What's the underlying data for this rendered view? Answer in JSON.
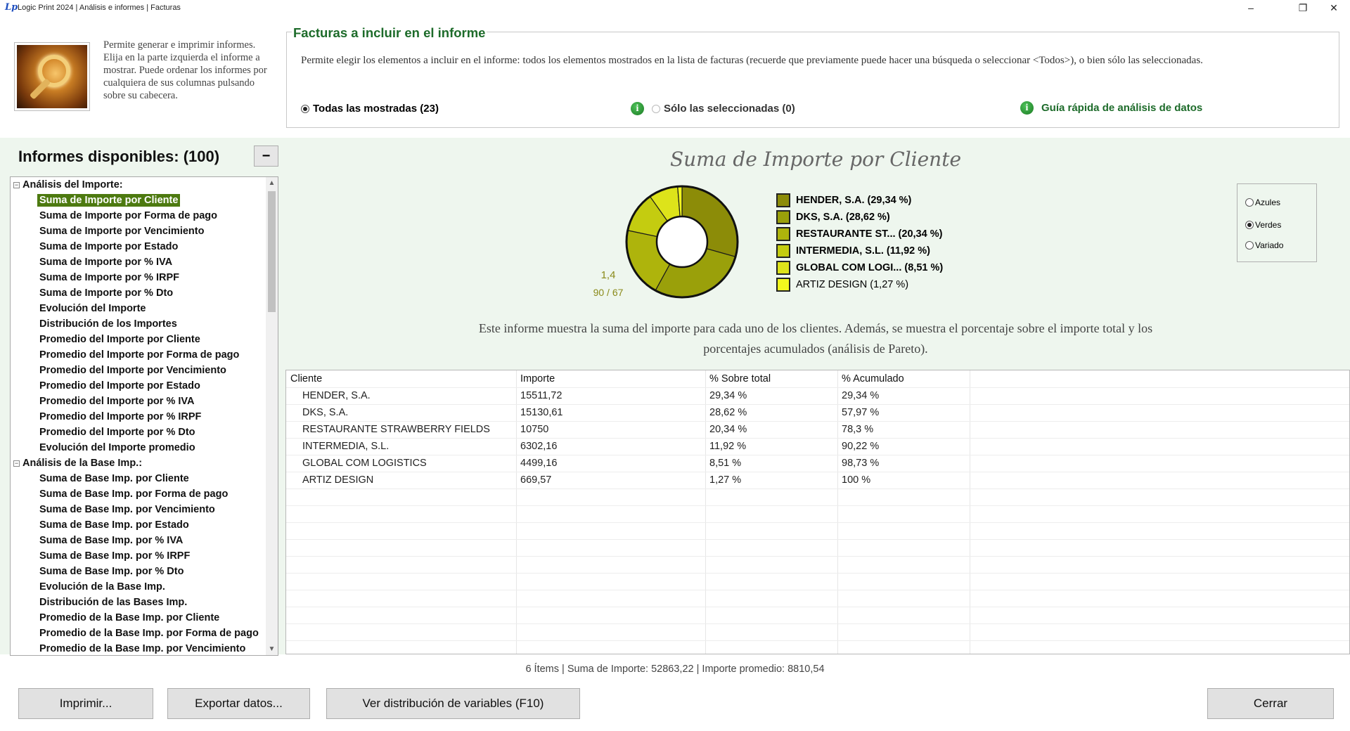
{
  "window": {
    "title": "Logic Print 2024 | Análisis e informes | Facturas",
    "logo": "Lp",
    "minimize": "–",
    "restore": "❐",
    "close": "✕"
  },
  "top": {
    "description": "Permite generar e imprimir informes. Elija en la parte izquierda el informe a mostrar. Puede ordenar los informes por cualquiera de sus columnas pulsando sobre su cabecera.",
    "frame_title": "Facturas a incluir en el informe",
    "frame_text": "Permite elegir los elementos a incluir en el informe: todos los elementos mostrados en la lista de facturas (recuerde que previamente puede hacer una búsqueda o seleccionar <Todos>), o bien sólo las seleccionadas.",
    "option_all": "Todas las mostradas (23)",
    "option_selected": "Sólo las seleccionadas (0)",
    "guide_link": "Guía rápida de análisis de datos",
    "info_glyph": "i"
  },
  "reports": {
    "title": "Informes disponibles:  (100)",
    "collapse_label": "−",
    "groups": [
      {
        "label": "Análisis del Importe:",
        "items": [
          "Suma de Importe por Cliente",
          "Suma de Importe por Forma de pago",
          "Suma de Importe por Vencimiento",
          "Suma de Importe por Estado",
          "Suma de Importe por % IVA",
          "Suma de Importe por % IRPF",
          "Suma de Importe por % Dto",
          "Evolución del Importe",
          "Distribución de los Importes",
          "Promedio del Importe por Cliente",
          "Promedio del Importe por Forma de pago",
          "Promedio del Importe por Vencimiento",
          "Promedio del Importe por Estado",
          "Promedio del Importe por % IVA",
          "Promedio del Importe por % IRPF",
          "Promedio del Importe por % Dto",
          "Evolución del Importe promedio"
        ]
      },
      {
        "label": "Análisis de la Base Imp.:",
        "items": [
          "Suma de Base Imp. por Cliente",
          "Suma de Base Imp. por Forma de pago",
          "Suma de Base Imp. por Vencimiento",
          "Suma de Base Imp. por Estado",
          "Suma de Base Imp. por % IVA",
          "Suma de Base Imp. por % IRPF",
          "Suma de Base Imp. por % Dto",
          "Evolución de la Base Imp.",
          "Distribución de las Bases Imp.",
          "Promedio de la Base Imp. por Cliente",
          "Promedio de la Base Imp. por Forma de pago",
          "Promedio de la Base Imp. por Vencimiento"
        ]
      }
    ],
    "selected": "Suma de Importe por Cliente"
  },
  "chart_data": {
    "type": "pie",
    "title": "Suma de Importe por Cliente",
    "categories": [
      "HENDER, S.A.",
      "DKS, S.A.",
      "RESTAURANTE STRAWBERRY FIELDS",
      "INTERMEDIA, S.L.",
      "GLOBAL COM LOGISTICS",
      "ARTIZ DESIGN"
    ],
    "values": [
      29.34,
      28.62,
      20.34,
      11.92,
      8.51,
      1.27
    ],
    "legend": [
      "HENDER, S.A. (29,34 %)",
      "DKS, S.A. (28,62 %)",
      "RESTAURANTE ST... (20,34 %)",
      "INTERMEDIA, S.L. (11,92 %)",
      "GLOBAL COM LOGI... (8,51 %)",
      "ARTIZ DESIGN (1,27 %)"
    ],
    "colors": [
      "#8c8c08",
      "#9aa00a",
      "#aeb40c",
      "#c4cc10",
      "#dde31a",
      "#f2f81e"
    ],
    "legend_placement": "right",
    "ratio_label": "1,4",
    "pareto_label": "90 / 67"
  },
  "color_scheme": {
    "options": [
      "Azules",
      "Verdes",
      "Variado"
    ],
    "selected": "Verdes"
  },
  "chart_description": "Este informe muestra la suma del importe para cada uno de los clientes. Además, se muestra el porcentaje sobre el importe total y los porcentajes acumulados (análisis de Pareto).",
  "table": {
    "columns": [
      "Cliente",
      "Importe",
      "% Sobre total",
      "% Acumulado"
    ],
    "rows": [
      [
        "HENDER, S.A.",
        "15511,72",
        "29,34 %",
        "29,34 %"
      ],
      [
        "DKS, S.A.",
        "15130,61",
        "28,62 %",
        "57,97 %"
      ],
      [
        "RESTAURANTE STRAWBERRY FIELDS",
        "10750",
        "20,34 %",
        "78,3 %"
      ],
      [
        "INTERMEDIA, S.L.",
        "6302,16",
        "11,92 %",
        "90,22 %"
      ],
      [
        "GLOBAL COM LOGISTICS",
        "4499,16",
        "8,51 %",
        "98,73 %"
      ],
      [
        "ARTIZ DESIGN",
        "669,57",
        "1,27 %",
        "100 %"
      ]
    ]
  },
  "status": "6 Ítems  |  Suma de Importe: 52863,22  |  Importe promedio: 8810,54",
  "buttons": {
    "print": "Imprimir...",
    "export": "Exportar datos...",
    "distribution": "Ver distribución de variables  (F10)",
    "close": "Cerrar"
  }
}
